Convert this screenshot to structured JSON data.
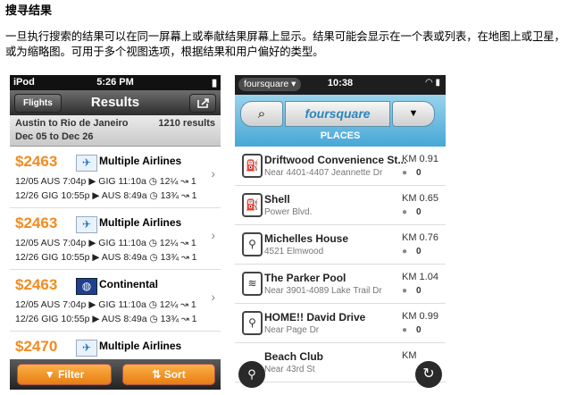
{
  "doc": {
    "title": "搜寻结果",
    "intro": "一旦执行搜索的结果可以在同一屏幕上或奉献结果屏幕上显示。结果可能会显示在一个表或列表，在地图上或卫星，或为缩略图。可用于多个视图选项，根据结果和用户偏好的类型。"
  },
  "phone1": {
    "status": {
      "carrier": "iPod",
      "time": "5:26 PM"
    },
    "nav": {
      "back": "Flights",
      "title": "Results"
    },
    "route": {
      "line1": "Austin to Rio de Janeiro",
      "line2": "Dec 05 to Dec 26",
      "count": "1210 results"
    },
    "results": [
      {
        "price": "$2463",
        "airline": "Multiple Airlines",
        "seg1": "12/05 AUS   7:04p ▶ GIG   11:10a ◷ 12¼ ↝ 1",
        "seg2": "12/26 GIG  10:55p ▶ AUS   8:49a ◷ 13¾ ↝ 1"
      },
      {
        "price": "$2463",
        "airline": "Multiple Airlines",
        "seg1": "12/05 AUS   7:04p ▶ GIG   11:10a ◷ 12¼ ↝ 1",
        "seg2": "12/26 GIG  10:55p ▶ AUS   8:49a ◷ 13¾ ↝ 1"
      },
      {
        "price": "$2463",
        "airline": "Continental",
        "seg1": "12/05 AUS   7:04p ▶ GIG   11:10a ◷ 12¼ ↝ 1",
        "seg2": "12/26 GIG  10:55p ▶ AUS   8:49a ◷ 13¾ ↝ 1"
      },
      {
        "price": "$2470",
        "airline": "Multiple Airlines",
        "seg1": "",
        "seg2": ""
      }
    ],
    "toolbar": {
      "filter": "Filter",
      "sort": "Sort"
    }
  },
  "phone2": {
    "status": {
      "brand": "foursquare ▾",
      "time": "10:38"
    },
    "logo": "foursquare",
    "section": "PLACES",
    "places": [
      {
        "name": "Driftwood Convenience St...",
        "address": "Near 4401-4407 Jeannette Dr",
        "distance": "KM 0.91",
        "people": "0"
      },
      {
        "name": "Shell",
        "address": "Power Blvd.",
        "distance": "KM 0.65",
        "people": "0"
      },
      {
        "name": "Michelles House",
        "address": "4521 Elmwood",
        "distance": "KM 0.76",
        "people": "0"
      },
      {
        "name": "The Parker Pool",
        "address": "Near 3901-4089 Lake Trail Dr",
        "distance": "KM 1.04",
        "people": "0"
      },
      {
        "name": "HOME!! David Drive",
        "address": "Near Page Dr",
        "distance": "KM 0.99",
        "people": "0"
      },
      {
        "name": "Beach Club",
        "address": "Near 43rd St",
        "distance": "KM",
        "people": ""
      }
    ]
  }
}
